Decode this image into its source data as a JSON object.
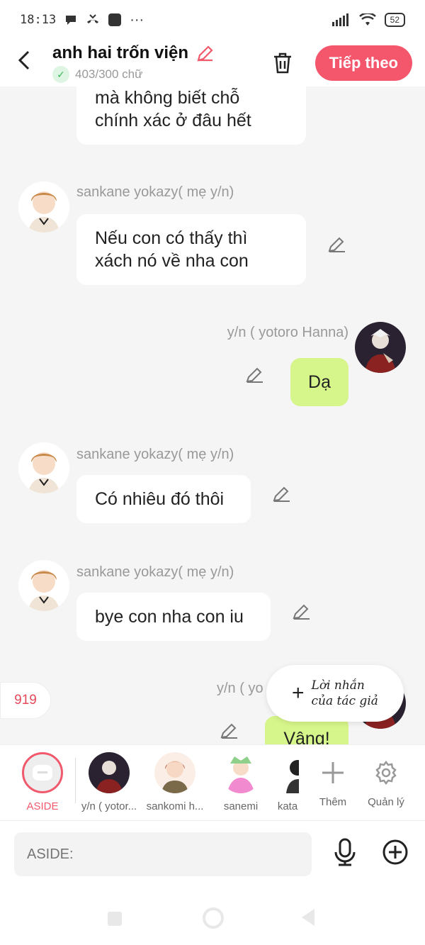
{
  "status_bar": {
    "time": "18:13",
    "battery": "52",
    "more": "···"
  },
  "header": {
    "title": "anh hai trốn viện",
    "word_count": "403/300 chữ",
    "next_label": "Tiếp theo"
  },
  "messages": [
    {
      "text": "mà không biết chỗ chính xác ở đâu hết",
      "side": "left"
    },
    {
      "author": "sankane yokazy( mẹ y/n)",
      "text": "Nếu con có thấy thì xách nó về nha con",
      "side": "left"
    },
    {
      "author": "y/n ( yotoro Hanna)",
      "text": "Dạ",
      "side": "right"
    },
    {
      "author": "sankane yokazy( mẹ y/n)",
      "text": "Có nhiêu đó thôi",
      "side": "left"
    },
    {
      "author": "sankane yokazy( mẹ y/n)",
      "text": "bye con nha con iu",
      "side": "left"
    },
    {
      "author": "y/n ( yo",
      "text": "Vâng!",
      "side": "right"
    }
  ],
  "count_badge": "919",
  "author_note": {
    "line1": "Lời nhắn",
    "line2": "của tác giả"
  },
  "characters": [
    {
      "label": "ASIDE",
      "icon": "aside-icon"
    },
    {
      "label": "y/n ( yotor..."
    },
    {
      "label": "sankomi h..."
    },
    {
      "label": "sanemi"
    },
    {
      "label": "kata"
    }
  ],
  "actions": {
    "add_label": "Thêm",
    "manage_label": "Quản lý"
  },
  "input": {
    "placeholder": "ASIDE:"
  },
  "colors": {
    "accent": "#f4566c",
    "bubble_right": "#d6f58a",
    "bubble_left": "#ffffff"
  }
}
